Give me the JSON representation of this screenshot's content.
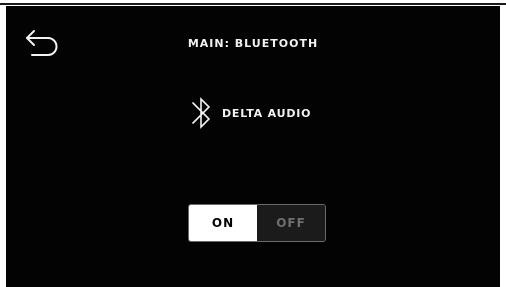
{
  "header": {
    "title": "MAIN: BLUETOOTH",
    "back_icon": "back-arrow-icon"
  },
  "device": {
    "icon": "bluetooth-icon",
    "name": "DELTA AUDIO"
  },
  "bluetooth_toggle": {
    "on_label": "ON",
    "off_label": "OFF",
    "selected": "ON"
  },
  "colors": {
    "background": "#030303",
    "text": "#f2f2f2",
    "toggle_active_bg": "#ffffff",
    "toggle_inactive_text": "#6f6f6f"
  }
}
